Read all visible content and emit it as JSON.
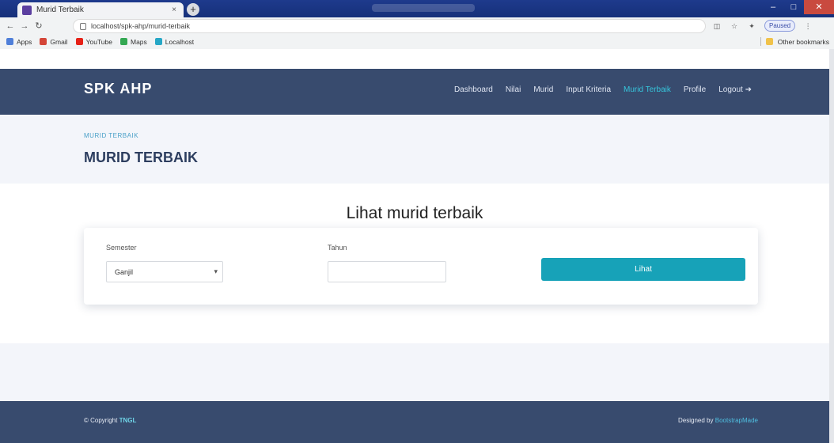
{
  "browser": {
    "tab_title": "Murid Terbaik",
    "tab_close": "×",
    "new_tab": "+",
    "url": "localhost/spk-ahp/murid-terbaik",
    "controls": {
      "minimize": "–",
      "maximize": "□",
      "close": "✕"
    },
    "bookmarks": [
      {
        "label": "Apps",
        "color": "#4f7fd9"
      },
      {
        "label": "Gmail",
        "color": "#d44638"
      },
      {
        "label": "YouTube",
        "color": "#e62117"
      },
      {
        "label": "Maps",
        "color": "#34a853"
      },
      {
        "label": "Localhost",
        "color": "#26a7c6"
      }
    ],
    "profile": "Paused",
    "other_bookmarks": "Other bookmarks"
  },
  "site": {
    "brand": "SPK AHP",
    "nav": [
      "Dashboard",
      "Nilai",
      "Murid",
      "Input Kriteria",
      "Murid Terbaik",
      "Profile",
      "Logout"
    ],
    "active_nav": "Murid Terbaik"
  },
  "hero": {
    "breadcrumb": "MURID TERBAIK",
    "title": "MURID TERBAIK"
  },
  "main": {
    "title": "Lihat murid terbaik",
    "form": {
      "semester_label": "Semester",
      "semester_value": "Ganjil",
      "tahun_label": "Tahun",
      "tahun_value": "",
      "tahun_placeholder": "",
      "submit_label": "Lihat"
    }
  },
  "footer": {
    "copyright_prefix": "© Copyright",
    "copyright_name": "TNGL",
    "designed_prefix": "Designed by",
    "designed_name": "BootstrapMade"
  }
}
